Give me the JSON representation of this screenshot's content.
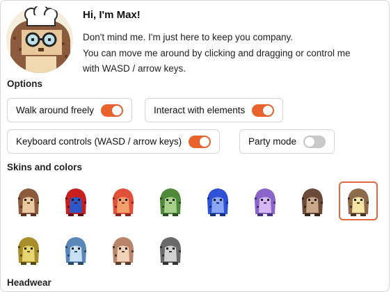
{
  "header": {
    "title": "Hi, I'm Max!",
    "description_line1": "Don't mind me. I'm just here to keep you company.",
    "description_line2": "You can move me around by clicking and dragging or control me",
    "description_line3": "with WASD / arrow keys."
  },
  "options": {
    "heading": "Options",
    "items": [
      {
        "label": "Walk around freely",
        "enabled": true
      },
      {
        "label": "Interact with elements",
        "enabled": true
      },
      {
        "label": "Keyboard controls (WASD / arrow keys)",
        "enabled": true
      },
      {
        "label": "Party mode",
        "enabled": false
      }
    ],
    "toggle_on_color": "#e8622c",
    "toggle_off_color": "#c9c9c9"
  },
  "skins": {
    "heading": "Skins and colors",
    "selected_index": 7,
    "selected_border_color": "#e0683a",
    "items": [
      {
        "name": "brown",
        "body": "#8c5a3c",
        "belly": "#e9c9a0",
        "dark": "#5a3520"
      },
      {
        "name": "spider",
        "body": "#c81e1e",
        "belly": "#2b57c8",
        "dark": "#6a0f0f"
      },
      {
        "name": "red-orange",
        "body": "#e0503a",
        "belly": "#f4a06a",
        "dark": "#8a2a1c"
      },
      {
        "name": "green",
        "body": "#4f8a3a",
        "belly": "#a8d08a",
        "dark": "#2c4f20"
      },
      {
        "name": "blue",
        "body": "#2f52d6",
        "belly": "#8aa6f4",
        "dark": "#17307f"
      },
      {
        "name": "purple",
        "body": "#8a66c8",
        "belly": "#d8b8f4",
        "dark": "#4a3080"
      },
      {
        "name": "dark-brown",
        "body": "#6a4a38",
        "belly": "#c8a888",
        "dark": "#3a2418"
      },
      {
        "name": "cream",
        "body": "#8c6a4a",
        "belly": "#f6e6a6",
        "dark": "#4a3422"
      },
      {
        "name": "olive",
        "body": "#a88e2a",
        "belly": "#e6d670",
        "dark": "#5a4a12"
      },
      {
        "name": "ice-blue",
        "body": "#5a86b8",
        "belly": "#c8e0f6",
        "dark": "#2a4a6a"
      },
      {
        "name": "tan",
        "body": "#b8846a",
        "belly": "#f0d2b8",
        "dark": "#5a3a28"
      },
      {
        "name": "gray",
        "body": "#6a6a6a",
        "belly": "#d2d2d2",
        "dark": "#333333"
      }
    ]
  },
  "next_section": {
    "heading": "Headwear"
  }
}
